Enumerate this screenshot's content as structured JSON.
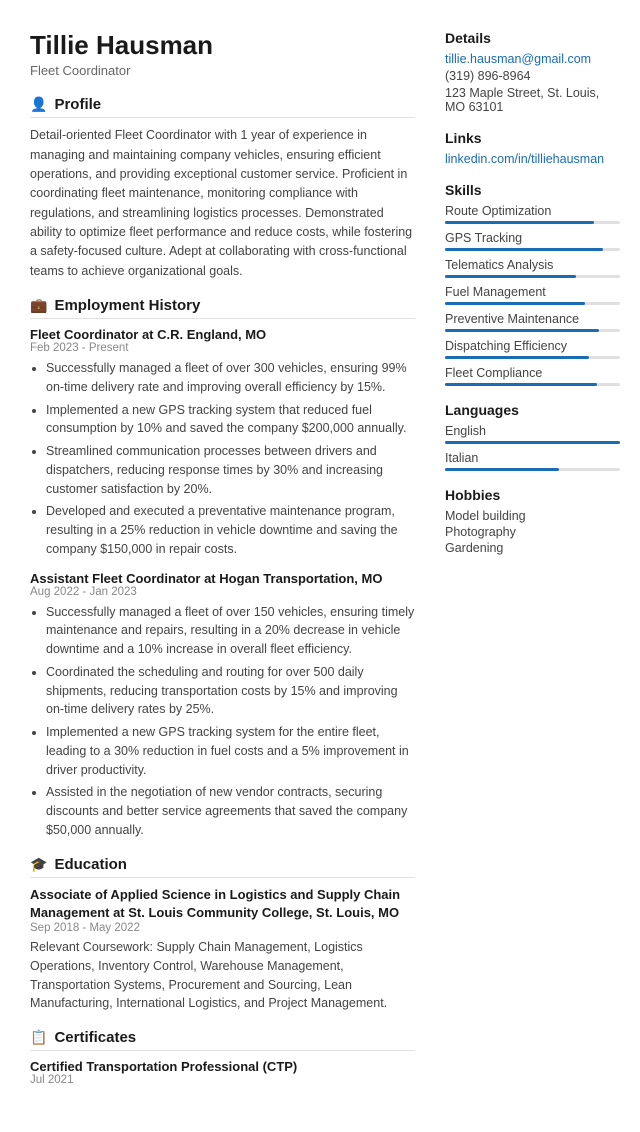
{
  "header": {
    "name": "Tillie Hausman",
    "title": "Fleet Coordinator"
  },
  "profile": {
    "section_title": "Profile",
    "text": "Detail-oriented Fleet Coordinator with 1 year of experience in managing and maintaining company vehicles, ensuring efficient operations, and providing exceptional customer service. Proficient in coordinating fleet maintenance, monitoring compliance with regulations, and streamlining logistics processes. Demonstrated ability to optimize fleet performance and reduce costs, while fostering a safety-focused culture. Adept at collaborating with cross-functional teams to achieve organizational goals."
  },
  "employment": {
    "section_title": "Employment History",
    "jobs": [
      {
        "title": "Fleet Coordinator at C.R. England, MO",
        "date": "Feb 2023 - Present",
        "bullets": [
          "Successfully managed a fleet of over 300 vehicles, ensuring 99% on-time delivery rate and improving overall efficiency by 15%.",
          "Implemented a new GPS tracking system that reduced fuel consumption by 10% and saved the company $200,000 annually.",
          "Streamlined communication processes between drivers and dispatchers, reducing response times by 30% and increasing customer satisfaction by 20%.",
          "Developed and executed a preventative maintenance program, resulting in a 25% reduction in vehicle downtime and saving the company $150,000 in repair costs."
        ]
      },
      {
        "title": "Assistant Fleet Coordinator at Hogan Transportation, MO",
        "date": "Aug 2022 - Jan 2023",
        "bullets": [
          "Successfully managed a fleet of over 150 vehicles, ensuring timely maintenance and repairs, resulting in a 20% decrease in vehicle downtime and a 10% increase in overall fleet efficiency.",
          "Coordinated the scheduling and routing for over 500 daily shipments, reducing transportation costs by 15% and improving on-time delivery rates by 25%.",
          "Implemented a new GPS tracking system for the entire fleet, leading to a 30% reduction in fuel costs and a 5% improvement in driver productivity.",
          "Assisted in the negotiation of new vendor contracts, securing discounts and better service agreements that saved the company $50,000 annually."
        ]
      }
    ]
  },
  "education": {
    "section_title": "Education",
    "degree": "Associate of Applied Science in Logistics and Supply Chain Management at St. Louis Community College, St. Louis, MO",
    "date": "Sep 2018 - May 2022",
    "coursework": "Relevant Coursework: Supply Chain Management, Logistics Operations, Inventory Control, Warehouse Management, Transportation Systems, Procurement and Sourcing, Lean Manufacturing, International Logistics, and Project Management."
  },
  "certificates": {
    "section_title": "Certificates",
    "items": [
      {
        "title": "Certified Transportation Professional (CTP)",
        "date": "Jul 2021"
      }
    ]
  },
  "details": {
    "section_title": "Details",
    "email": "tillie.hausman@gmail.com",
    "phone": "(319) 896-8964",
    "address": "123 Maple Street, St. Louis, MO 63101"
  },
  "links": {
    "section_title": "Links",
    "linkedin": "linkedin.com/in/tilliehausman"
  },
  "skills": {
    "section_title": "Skills",
    "items": [
      {
        "label": "Route Optimization",
        "percent": 85
      },
      {
        "label": "GPS Tracking",
        "percent": 90
      },
      {
        "label": "Telematics Analysis",
        "percent": 75
      },
      {
        "label": "Fuel Management",
        "percent": 80
      },
      {
        "label": "Preventive Maintenance",
        "percent": 88
      },
      {
        "label": "Dispatching Efficiency",
        "percent": 82
      },
      {
        "label": "Fleet Compliance",
        "percent": 87
      }
    ]
  },
  "languages": {
    "section_title": "Languages",
    "items": [
      {
        "label": "English",
        "percent": 100
      },
      {
        "label": "Italian",
        "percent": 65
      }
    ]
  },
  "hobbies": {
    "section_title": "Hobbies",
    "items": [
      "Model building",
      "Photography",
      "Gardening"
    ]
  }
}
